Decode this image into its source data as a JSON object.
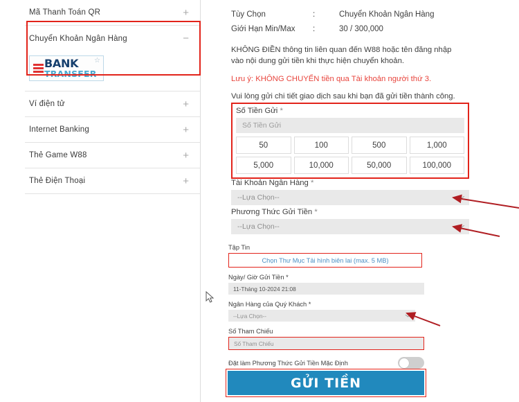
{
  "sidebar": {
    "items": [
      {
        "label": "Mã Thanh Toán QR",
        "toggle": "+",
        "expanded": false
      },
      {
        "label": "Chuyển Khoản Ngân Hàng",
        "toggle": "−",
        "expanded": true
      },
      {
        "label": "Ví điện tử",
        "toggle": "+",
        "expanded": false
      },
      {
        "label": "Internet Banking",
        "toggle": "+",
        "expanded": false
      },
      {
        "label": "Thẻ Game W88",
        "toggle": "+",
        "expanded": false
      },
      {
        "label": "Thẻ Điện Thoại",
        "toggle": "+",
        "expanded": false
      }
    ],
    "bank_logo": {
      "primary_text": "BANK",
      "secondary_text": "TRANSFER",
      "star": "☆",
      "stripe_color": "#e03131",
      "primary_color": "#17406e",
      "secondary_color": "#4aa8cf"
    }
  },
  "panel": {
    "info_rows": [
      {
        "key": "Tùy Chọn",
        "colon": ":",
        "value": "Chuyển Khoản Ngân Hàng"
      },
      {
        "key": "Giới Hạn Min/Max",
        "colon": ":",
        "value": "30 / 300,000"
      }
    ],
    "notes": {
      "primary": "KHÔNG ĐIỀN thông tin liên quan đến W88 hoặc tên đăng nhập vào nội dung gửi tiền khi thực hiện chuyển khoản.",
      "warning": "Lưu ý: KHÔNG CHUYỂN tiền qua Tài khoản người thứ 3.",
      "footer": "Vui lòng gửi chi tiết giao dịch sau khi bạn đã gửi tiền thành công.",
      "warning_color": "#e8443c"
    },
    "amount": {
      "label": "Số Tiền Gửi",
      "required_mark": "*",
      "placeholder": "Số Tiền Gửi",
      "quick_values": [
        "50",
        "100",
        "500",
        "1,000",
        "5,000",
        "10,000",
        "50,000",
        "100,000"
      ]
    },
    "bank_account": {
      "label": "Tài Khoản Ngân Hàng",
      "required_mark": "*",
      "selected": "--Lựa Chọn--"
    },
    "deposit_method": {
      "label": "Phương Thức Gửi Tiền",
      "required_mark": "*",
      "selected": "--Lựa Chọn--"
    },
    "file": {
      "label": "Tập Tin",
      "button": "Chọn Thư Mục Tải hình biên lai (max. 5 MB)"
    },
    "datetime": {
      "label": "Ngày/ Giờ Gửi Tiền",
      "required_mark": "*",
      "value": "11-Tháng 10-2024 21:08"
    },
    "customer_bank": {
      "label": "Ngân Hàng của Quý Khách",
      "required_mark": "*",
      "selected": "--Lựa Chọn--"
    },
    "reference": {
      "label": "Số Tham Chiếu",
      "placeholder": "Số Tham Chiếu"
    },
    "default_toggle": {
      "label": "Đặt làm Phương Thức Gửi Tiền Mặc Định",
      "state": "off"
    },
    "submit": {
      "label": "GỬI TIỀN",
      "color": "#2189bd"
    }
  },
  "annotations": {
    "box_color": "#e2231a",
    "arrow_color": "#b01e23",
    "arrow_count": 3
  }
}
